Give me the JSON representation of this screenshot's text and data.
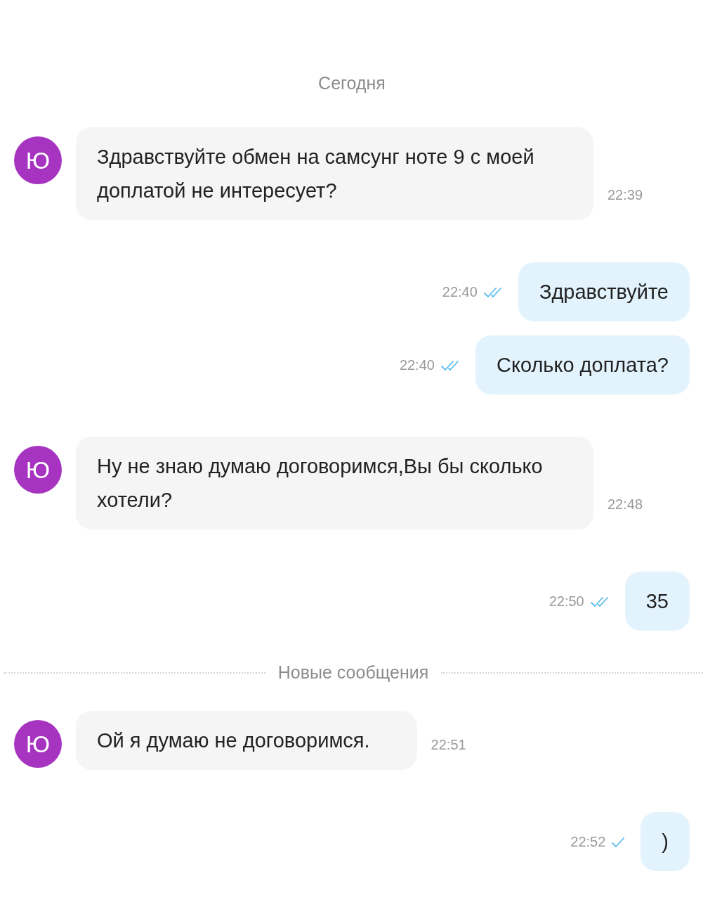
{
  "chat": [
    {
      "kind": "date",
      "text": "Сегодня"
    },
    {
      "kind": "message",
      "outgoing": false,
      "avatar": "Ю",
      "text": "Здравствуйте обмен на самсунг ноте 9 с моей доплатой не интересует?",
      "time": "22:39"
    },
    {
      "kind": "message",
      "outgoing": true,
      "text": "Здравствуйте",
      "time": "22:40",
      "read": true
    },
    {
      "kind": "message",
      "outgoing": true,
      "text": "Сколько доплата?",
      "time": "22:40",
      "read": true
    },
    {
      "kind": "message",
      "outgoing": false,
      "avatar": "Ю",
      "text": "Ну не знаю думаю договоримся,Вы бы сколько хотели?",
      "time": "22:48"
    },
    {
      "kind": "message",
      "outgoing": true,
      "text": "35",
      "time": "22:50",
      "read": true
    },
    {
      "kind": "divider",
      "text": "Новые сообщения"
    },
    {
      "kind": "message",
      "outgoing": false,
      "avatar": "Ю",
      "text": "Ой я думаю не договоримся.",
      "time": "22:51"
    },
    {
      "kind": "message",
      "outgoing": true,
      "text": ")",
      "time": "22:52",
      "read": false
    }
  ]
}
